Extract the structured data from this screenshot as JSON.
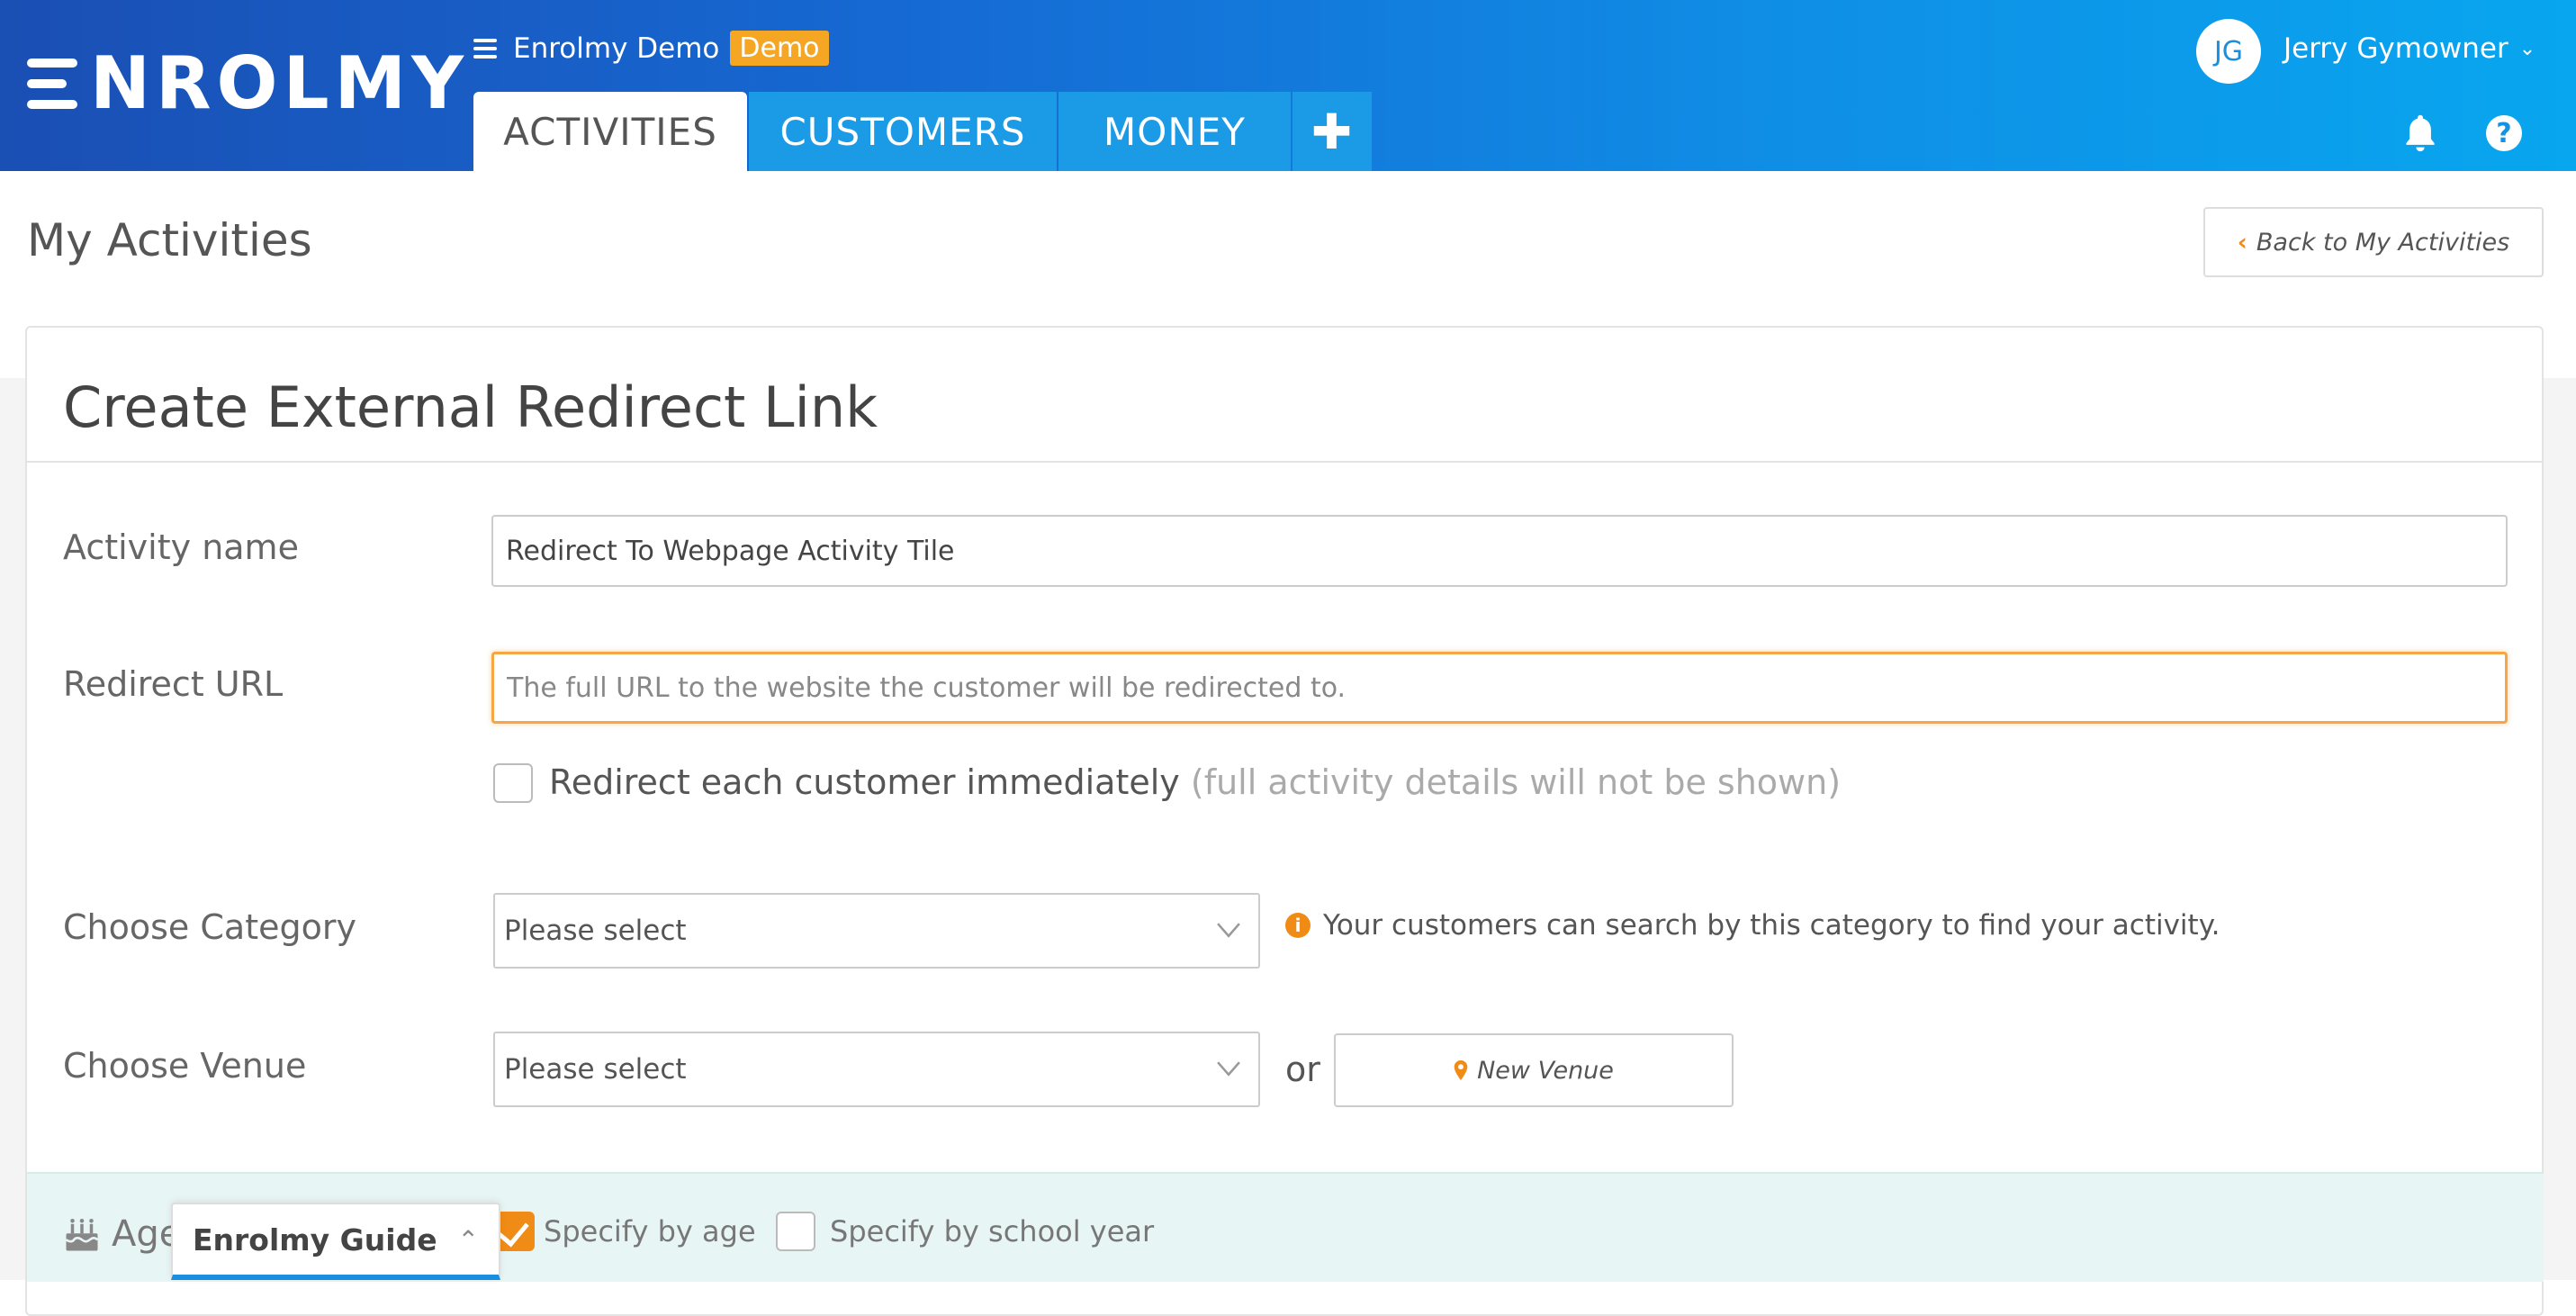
{
  "header": {
    "logo_text": "NROLMY",
    "org_name": "Enrolmy Demo",
    "demo_badge": "Demo",
    "tabs": [
      {
        "label": "ACTIVITIES",
        "active": true
      },
      {
        "label": "CUSTOMERS",
        "active": false
      },
      {
        "label": "MONEY",
        "active": false
      },
      {
        "label": "✚",
        "active": false
      }
    ],
    "user": {
      "initials": "JG",
      "name": "Jerry Gymowner"
    },
    "colors": {
      "gradient_start": "#1a4fb4",
      "gradient_end": "#08a6ef"
    }
  },
  "page": {
    "title": "My Activities",
    "back_button": "Back to My Activities"
  },
  "form": {
    "title": "Create External Redirect Link",
    "activity_name": {
      "label": "Activity name",
      "value": "Redirect To Webpage Activity Tile"
    },
    "redirect_url": {
      "label": "Redirect URL",
      "value": "",
      "placeholder": "The full URL to the website the customer will be redirected to."
    },
    "redirect_immediately": {
      "label": "Redirect each customer immediately",
      "note": "(full activity details will not be shown)",
      "checked": false
    },
    "category": {
      "label": "Choose Category",
      "selected": "Please select",
      "info": "Your customers can search by this category to find your activity."
    },
    "venue": {
      "label": "Choose Venue",
      "selected": "Please select",
      "or": "or",
      "new_venue": "New Venue"
    },
    "age": {
      "label": "Age",
      "specify_by_age": {
        "label": "Specify by age",
        "checked": true
      },
      "specify_by_school_year": {
        "label": "Specify by school year",
        "checked": false
      }
    }
  },
  "guide": {
    "label": "Enrolmy Guide"
  },
  "accent_color": "#f08c16"
}
